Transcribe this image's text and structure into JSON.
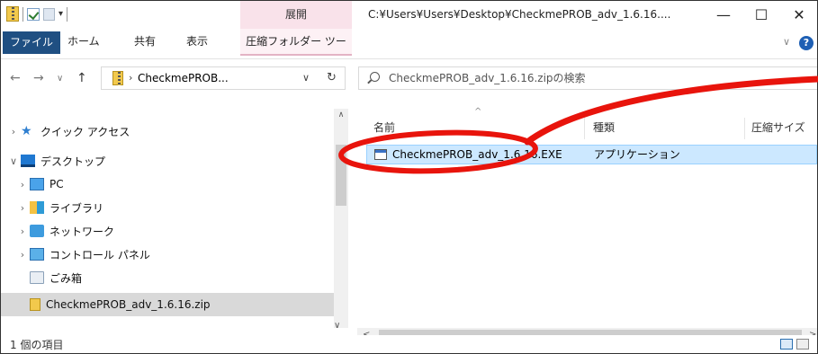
{
  "titlebar": {
    "context_tab": "展開",
    "path": "C:¥Users¥Users¥Desktop¥CheckmePROB_adv_1.6.16....",
    "minimize": "—",
    "maximize": "☐",
    "close": "✕"
  },
  "ribbon": {
    "tabs": [
      "ファイル",
      "ホーム",
      "共有",
      "表示"
    ],
    "context_tab": "圧縮フォルダー ツール",
    "expand": "∨",
    "help": "?"
  },
  "address": {
    "back": "←",
    "forward": "→",
    "recent": "∨",
    "up": "↑",
    "separator": "›",
    "text": "CheckmePROB...",
    "dropdown": "∨",
    "refresh": "↻",
    "search_placeholder": "CheckmePROB_adv_1.6.16.zipの検索"
  },
  "navpane": {
    "items": [
      {
        "chevron": "›",
        "label": "クイック アクセス"
      },
      {
        "chevron": "∨",
        "label": "デスクトップ"
      },
      {
        "chevron": "›",
        "label": "PC"
      },
      {
        "chevron": "›",
        "label": "ライブラリ"
      },
      {
        "chevron": "›",
        "label": "ネットワーク"
      },
      {
        "chevron": "›",
        "label": "コントロール パネル"
      },
      {
        "chevron": "",
        "label": "ごみ箱"
      },
      {
        "chevron": "",
        "label": "CheckmePROB_adv_1.6.16.zip"
      }
    ],
    "scroll_up": "∧",
    "scroll_down": "∨"
  },
  "filepane": {
    "columns": [
      "名前",
      "種類",
      "圧縮サイズ"
    ],
    "sort_caret": "^",
    "rows": [
      {
        "name": "CheckmePROB_adv_1.6.16.EXE",
        "type": "アプリケーション"
      }
    ],
    "scroll_left": "<",
    "scroll_right": ">"
  },
  "status": {
    "text": "1 個の項目"
  },
  "colors": {
    "file_tab": "#1f4f82",
    "context_tab": "#f9e2ea",
    "selection": "#cce8ff",
    "annotation": "#e8140c"
  }
}
